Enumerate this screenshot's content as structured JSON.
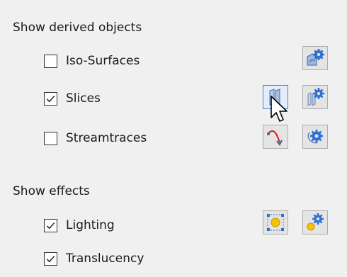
{
  "derived": {
    "title": "Show derived objects",
    "items": [
      {
        "label": "Iso-Surfaces",
        "checked": false
      },
      {
        "label": "Slices",
        "checked": true
      },
      {
        "label": "Streamtraces",
        "checked": false
      }
    ]
  },
  "effects": {
    "title": "Show effects",
    "items": [
      {
        "label": "Lighting",
        "checked": true
      },
      {
        "label": "Translucency",
        "checked": true
      }
    ]
  },
  "icons": {
    "iso_details": "iso-surface-details-gear-icon",
    "slice_interactive": "slice-interactive-icon",
    "slice_details": "slice-details-gear-icon",
    "streamtrace_add": "streamtrace-add-icon",
    "streamtrace_details": "streamtrace-details-gear-icon",
    "lighting_effect": "lighting-effect-icon",
    "lighting_details": "lighting-details-gear-icon"
  },
  "colors": {
    "background": "#f0f0f0",
    "hover_border": "#3c8ad6",
    "gear": "#2f6fd1",
    "light_yellow": "#f5c400",
    "stream_red": "#d32020"
  }
}
